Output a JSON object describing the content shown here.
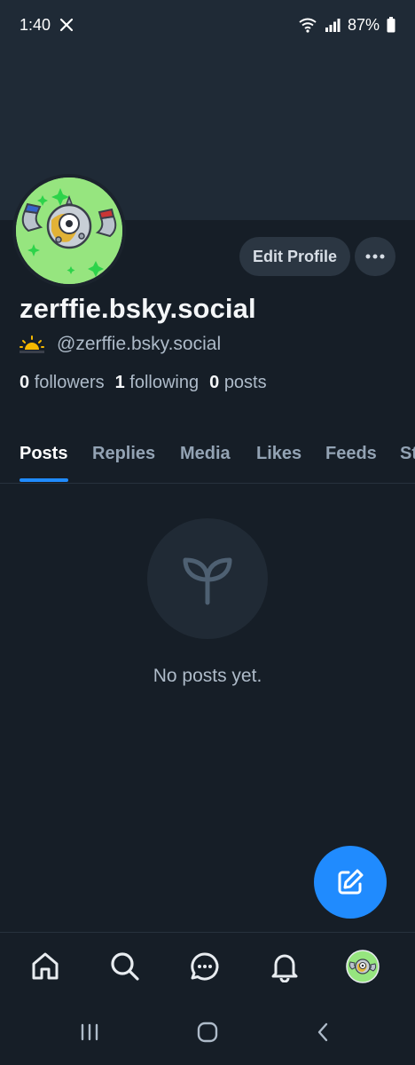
{
  "status_bar": {
    "time": "1:40",
    "battery": "87%"
  },
  "profile": {
    "display_name": "zerffie.bsky.social",
    "handle": "@zerffie.bsky.social",
    "edit_label": "Edit Profile",
    "stats": {
      "followers_count": "0",
      "followers_label": "followers",
      "following_count": "1",
      "following_label": "following",
      "posts_count": "0",
      "posts_label": "posts"
    }
  },
  "tabs": [
    {
      "label": "Posts",
      "active": true
    },
    {
      "label": "Replies"
    },
    {
      "label": "Media"
    },
    {
      "label": "Likes"
    },
    {
      "label": "Feeds"
    },
    {
      "label": "St"
    }
  ],
  "empty_state": {
    "message": "No posts yet.",
    "icon": "seedling-icon"
  },
  "bottom_nav": [
    "home-icon",
    "search-icon",
    "chat-icon",
    "bell-icon",
    "avatar"
  ],
  "colors": {
    "background": "#161e27",
    "banner": "#1f2a36",
    "accent": "#208bfe",
    "avatar_bg": "#96e57f"
  }
}
